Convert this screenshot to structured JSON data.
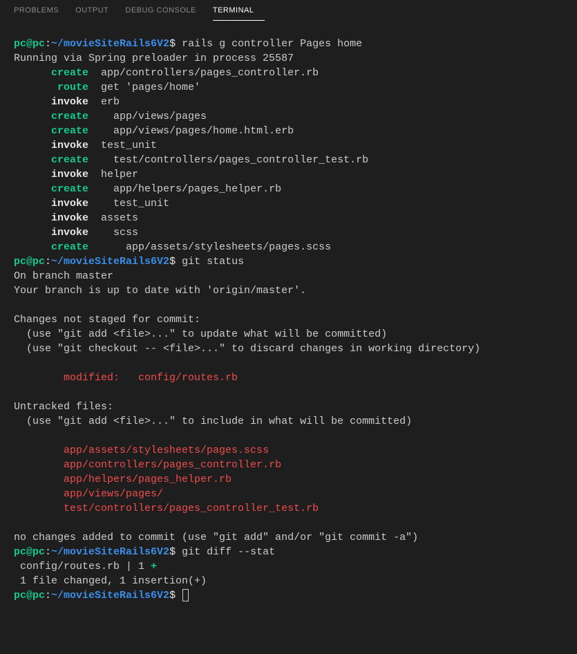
{
  "tabs": {
    "problems": "PROBLEMS",
    "output": "OUTPUT",
    "debug": "DEBUG CONSOLE",
    "terminal": "TERMINAL"
  },
  "prompt": {
    "user": "pc@pc",
    "colon": ":",
    "path": "~/movieSiteRails6V2",
    "dollar": "$ "
  },
  "cmd1": "rails g controller Pages home",
  "line2": "Running via Spring preloader in process 25587",
  "rails": {
    "l1a": "      ",
    "l1b": "create",
    "l1c": "  app/controllers/pages_controller.rb",
    "l2a": "       ",
    "l2b": "route",
    "l2c": "  get 'pages/home'",
    "l3a": "      ",
    "l3b": "invoke",
    "l3c": "  erb",
    "l4a": "      ",
    "l4b": "create",
    "l4c": "    app/views/pages",
    "l5a": "      ",
    "l5b": "create",
    "l5c": "    app/views/pages/home.html.erb",
    "l6a": "      ",
    "l6b": "invoke",
    "l6c": "  test_unit",
    "l7a": "      ",
    "l7b": "create",
    "l7c": "    test/controllers/pages_controller_test.rb",
    "l8a": "      ",
    "l8b": "invoke",
    "l8c": "  helper",
    "l9a": "      ",
    "l9b": "create",
    "l9c": "    app/helpers/pages_helper.rb",
    "l10a": "      ",
    "l10b": "invoke",
    "l10c": "    test_unit",
    "l11a": "      ",
    "l11b": "invoke",
    "l11c": "  assets",
    "l12a": "      ",
    "l12b": "invoke",
    "l12c": "    scss",
    "l13a": "      ",
    "l13b": "create",
    "l13c": "      app/assets/stylesheets/pages.scss"
  },
  "cmd2": "git status",
  "git": {
    "branch": "On branch master",
    "uptodate": "Your branch is up to date with 'origin/master'.",
    "blank": "",
    "notstaged": "Changes not staged for commit:",
    "hint1": "  (use \"git add <file>...\" to update what will be committed)",
    "hint2": "  (use \"git checkout -- <file>...\" to discard changes in working directory)",
    "modpad": "        ",
    "modified": "modified:   config/routes.rb",
    "untracked": "Untracked files:",
    "hint3": "  (use \"git add <file>...\" to include in what will be committed)",
    "u1pad": "        ",
    "u1": "app/assets/stylesheets/pages.scss",
    "u2pad": "        ",
    "u2": "app/controllers/pages_controller.rb",
    "u3pad": "        ",
    "u3": "app/helpers/pages_helper.rb",
    "u4pad": "        ",
    "u4": "app/views/pages/",
    "u5pad": "        ",
    "u5": "test/controllers/pages_controller_test.rb",
    "nochanges": "no changes added to commit (use \"git add\" and/or \"git commit -a\")"
  },
  "cmd3": "git diff --stat",
  "diff": {
    "line1a": " config/routes.rb | 1 ",
    "line1b": "+",
    "line2": " 1 file changed, 1 insertion(+)"
  }
}
